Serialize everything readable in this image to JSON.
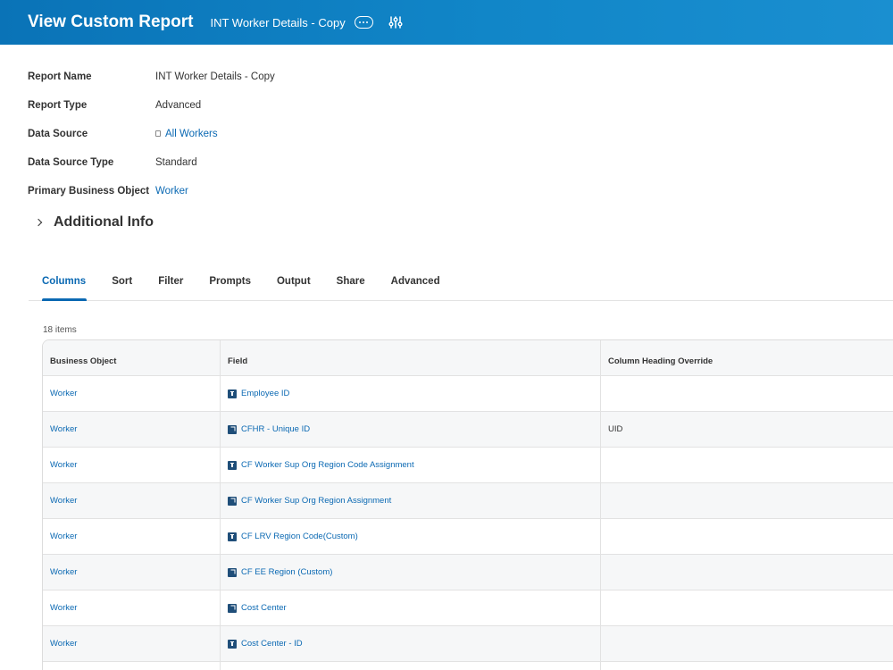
{
  "header": {
    "title": "View Custom Report",
    "report_name": "INT Worker Details - Copy",
    "more_icon": "ellipsis-icon",
    "settings_icon": "tune-icon"
  },
  "info": {
    "rows": [
      {
        "label": "Report Name",
        "value": "INT Worker Details - Copy"
      },
      {
        "label": "Report Type",
        "value": "Advanced"
      },
      {
        "label": "Data Source",
        "value": "All Workers"
      },
      {
        "label": "Data Source Type",
        "value": "Standard"
      },
      {
        "label": "Primary Business Object",
        "value": "Worker"
      }
    ]
  },
  "additional": {
    "title": "Additional Info"
  },
  "tabs": [
    "Columns",
    "Sort",
    "Filter",
    "Prompts",
    "Output",
    "Share",
    "Advanced"
  ],
  "table": {
    "count": "18 items",
    "headers": [
      "Business Object",
      "Field",
      "Column Heading Override"
    ],
    "rows": [
      {
        "object": "Worker",
        "field": "Employee ID",
        "override": "",
        "icon": "text-field-icon"
      },
      {
        "object": "Worker",
        "field": "CFHR - Unique ID",
        "override": "UID",
        "icon": "reference-field-icon"
      },
      {
        "object": "Worker",
        "field": "CF Worker Sup Org Region Code Assignment",
        "override": "",
        "icon": "text-field-icon"
      },
      {
        "object": "Worker",
        "field": "CF Worker Sup Org Region Assignment",
        "override": "",
        "icon": "reference-field-icon"
      },
      {
        "object": "Worker",
        "field": "CF LRV Region Code(Custom)",
        "override": "",
        "icon": "text-field-icon"
      },
      {
        "object": "Worker",
        "field": "CF EE Region (Custom)",
        "override": "",
        "icon": "reference-field-icon"
      },
      {
        "object": "Worker",
        "field": "Cost Center",
        "override": "",
        "icon": "reference-field-icon"
      },
      {
        "object": "Worker",
        "field": "Cost Center - ID",
        "override": "",
        "icon": "text-field-icon"
      }
    ]
  },
  "colors": {
    "header_bg": "#0a73b7",
    "link": "#0b69b3",
    "row_alt": "#f6f7f8"
  }
}
